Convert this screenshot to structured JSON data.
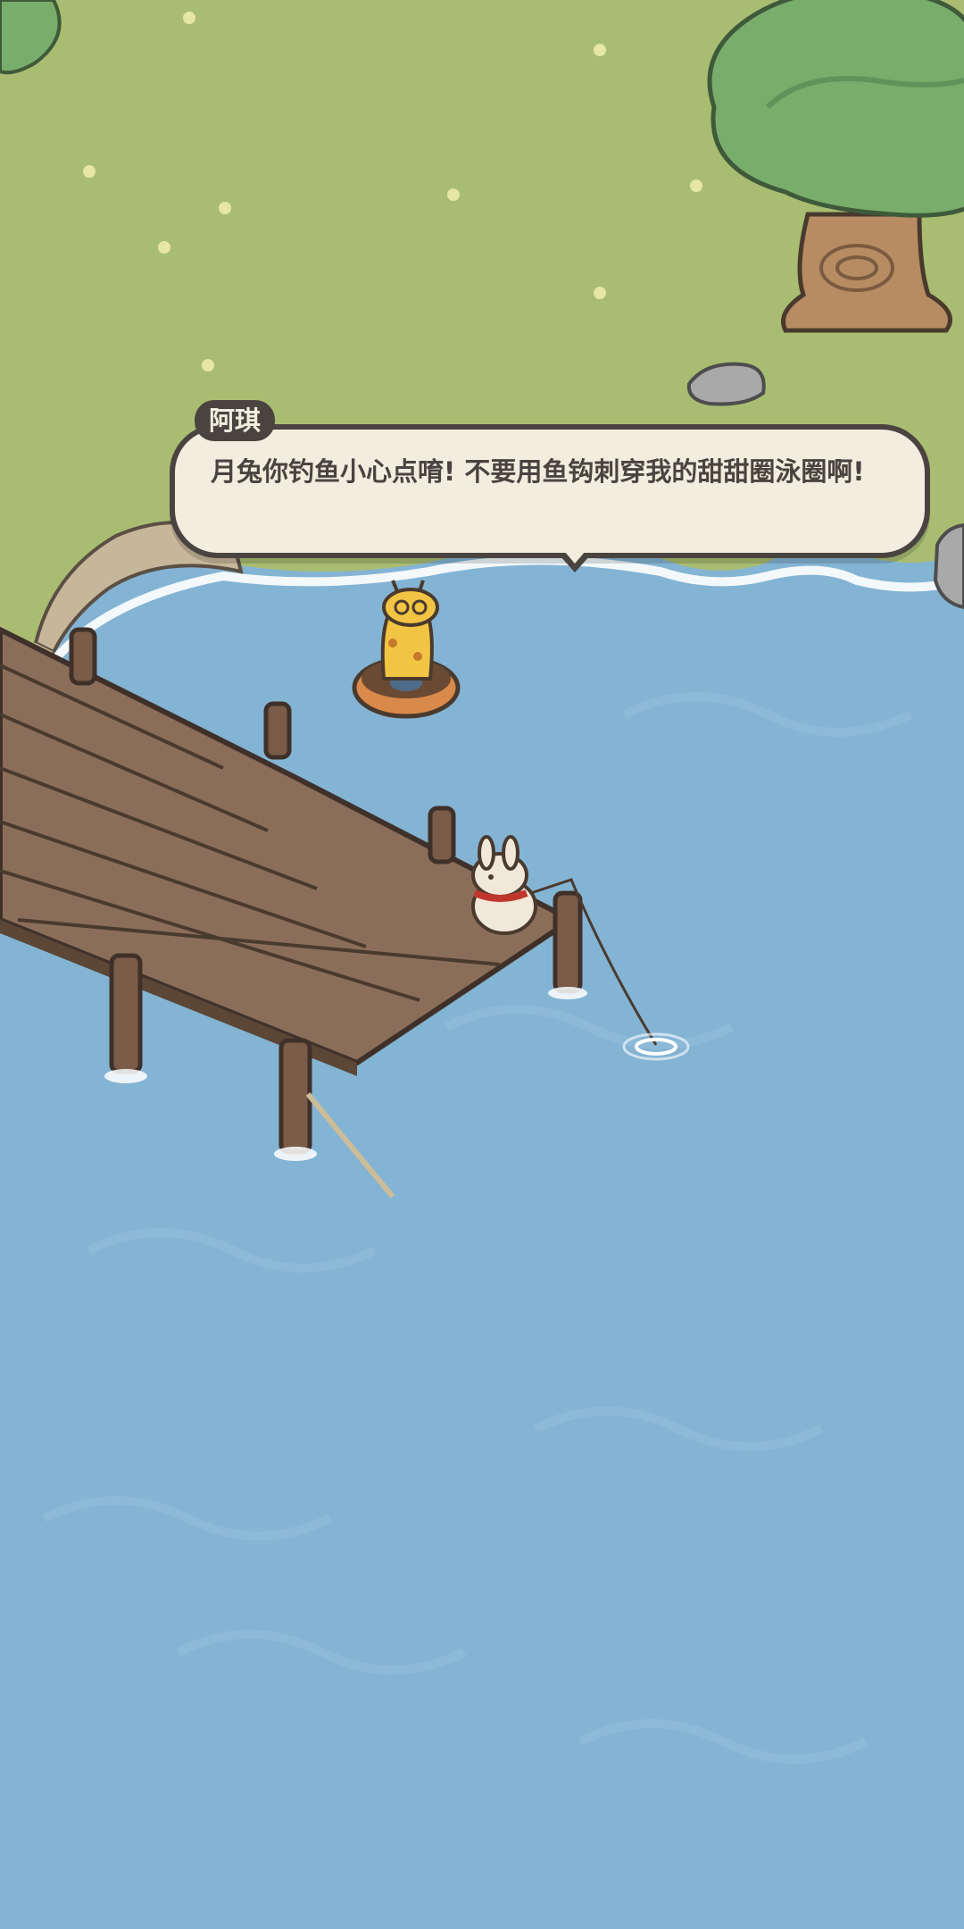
{
  "dialogue": {
    "speaker": "阿琪",
    "text": "月兔你钓鱼小心点唷! 不要用鱼钩刺穿我的甜甜圈泳圈啊!"
  },
  "colors": {
    "grass": "#a9bd72",
    "water": "#84b4d4",
    "dock": "#8b6e5a",
    "bubble": "#f2eedf",
    "outline": "#4a4440"
  },
  "icons": {
    "tree": "tree-icon",
    "rock": "rock-icon",
    "giraffe": "giraffe-character",
    "rabbit": "rabbit-character"
  }
}
